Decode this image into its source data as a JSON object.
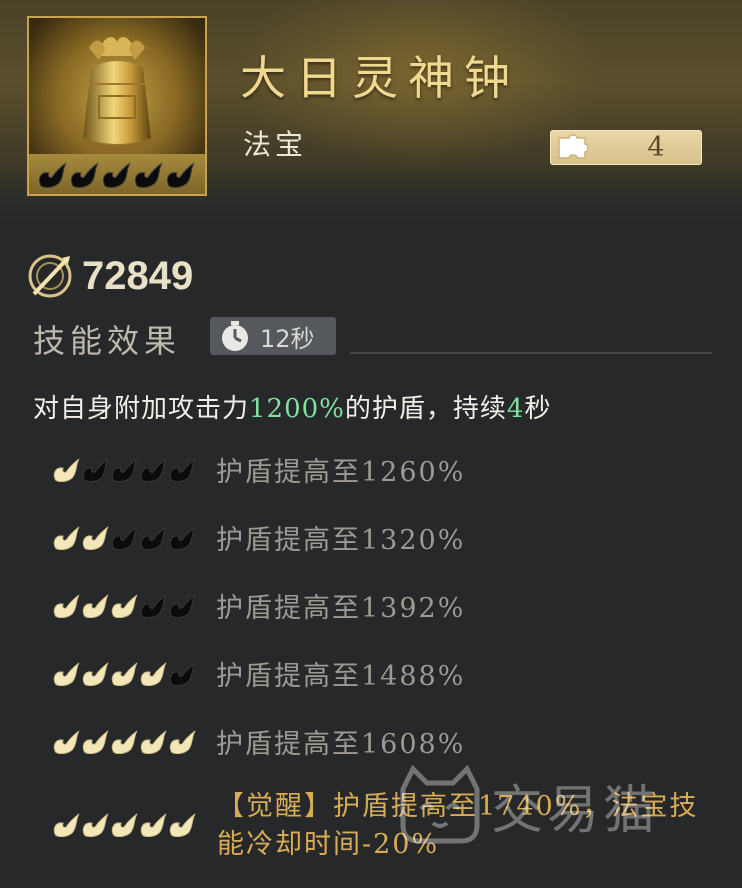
{
  "item": {
    "name": "大日灵神钟",
    "type": "法宝",
    "icon": "golden-bell-icon",
    "fragment_count": "4",
    "icon_stars_filled": 5,
    "icon_stars_total": 5
  },
  "power": {
    "icon": "power-swirl-icon",
    "value": "72849"
  },
  "skill": {
    "label": "技能效果",
    "cooldown": "12秒",
    "cooldown_icon": "stopwatch-icon",
    "description": {
      "part1": "对自身附加攻击力",
      "value": "1200%",
      "part2": "的护盾，持续",
      "duration": "4",
      "part3": "秒"
    }
  },
  "levels": [
    {
      "filled": 1,
      "text": "护盾提高至1260%"
    },
    {
      "filled": 2,
      "text": "护盾提高至1320%"
    },
    {
      "filled": 3,
      "text": "护盾提高至1392%"
    },
    {
      "filled": 4,
      "text": "护盾提高至1488%"
    },
    {
      "filled": 5,
      "text": "护盾提高至1608%"
    }
  ],
  "awaken": {
    "filled": 5,
    "text": "【觉醒】护盾提高至1740%，法宝技能冷却时间-20%"
  },
  "watermark": {
    "text": "交易猫",
    "icon": "cat-logo-icon"
  },
  "colors": {
    "gold": "#f0d890",
    "green_highlight": "#7fe0a0",
    "awaken": "#d8ac56",
    "star_filled": "#f3e6b8",
    "star_empty": "#0b0b0b"
  }
}
